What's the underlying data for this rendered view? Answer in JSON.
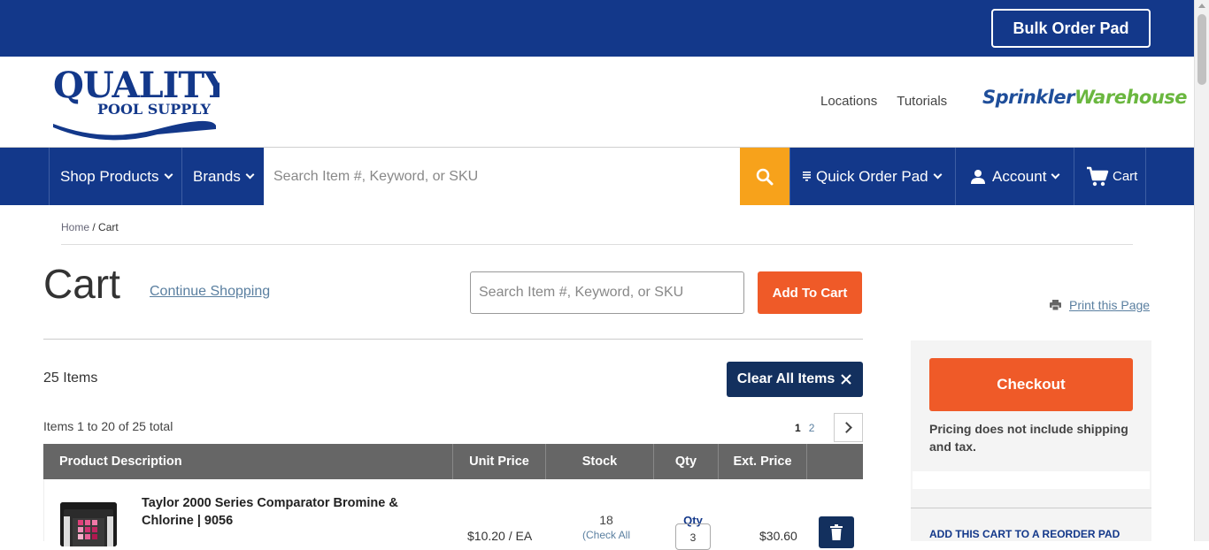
{
  "topbar": {
    "bulk_order_label": "Bulk Order Pad"
  },
  "header": {
    "logo_text_main": "QUALITY",
    "logo_text_sub": "POOL SUPPLY",
    "links": [
      "Locations",
      "Tutorials"
    ],
    "partner_logo_a": "Sprinkler",
    "partner_logo_b": "Warehouse"
  },
  "nav": {
    "shop_products": "Shop Products",
    "brands": "Brands",
    "search_placeholder": "Search Item #, Keyword, or SKU",
    "quick_order": "Quick Order Pad",
    "account": "Account",
    "cart": "Cart"
  },
  "breadcrumb": {
    "home": "Home",
    "separator": "/",
    "current": "Cart"
  },
  "cart": {
    "title": "Cart",
    "continue_shopping": "Continue Shopping",
    "add_search_placeholder": "Search Item #, Keyword, or SKU",
    "add_to_cart": "Add To Cart",
    "print_page": "Print this Page",
    "item_count": "25 Items",
    "clear_all": "Clear All Items",
    "range_text": "Items 1 to 20 of 25 total",
    "pages": [
      "1",
      "2"
    ]
  },
  "table": {
    "headers": [
      "Product Description",
      "Unit Price",
      "Stock",
      "Qty",
      "Ext. Price"
    ],
    "rows": [
      {
        "name": "Taylor 2000 Series Comparator Bromine & Chlorine | 9056",
        "unit_price": "$10.20 / EA",
        "stock": "18",
        "stock_link": "(Check All",
        "qty_label": "Qty",
        "qty": "3",
        "ext_price": "$30.60"
      }
    ]
  },
  "sidebar": {
    "checkout": "Checkout",
    "pricing_note": "Pricing does not include shipping and tax.",
    "reorder": "ADD THIS CART TO A REORDER PAD"
  },
  "colors": {
    "brand_blue": "#13388a",
    "accent_orange": "#ef5a28",
    "search_orange": "#f7a21b",
    "dark_navy": "#13305e"
  }
}
